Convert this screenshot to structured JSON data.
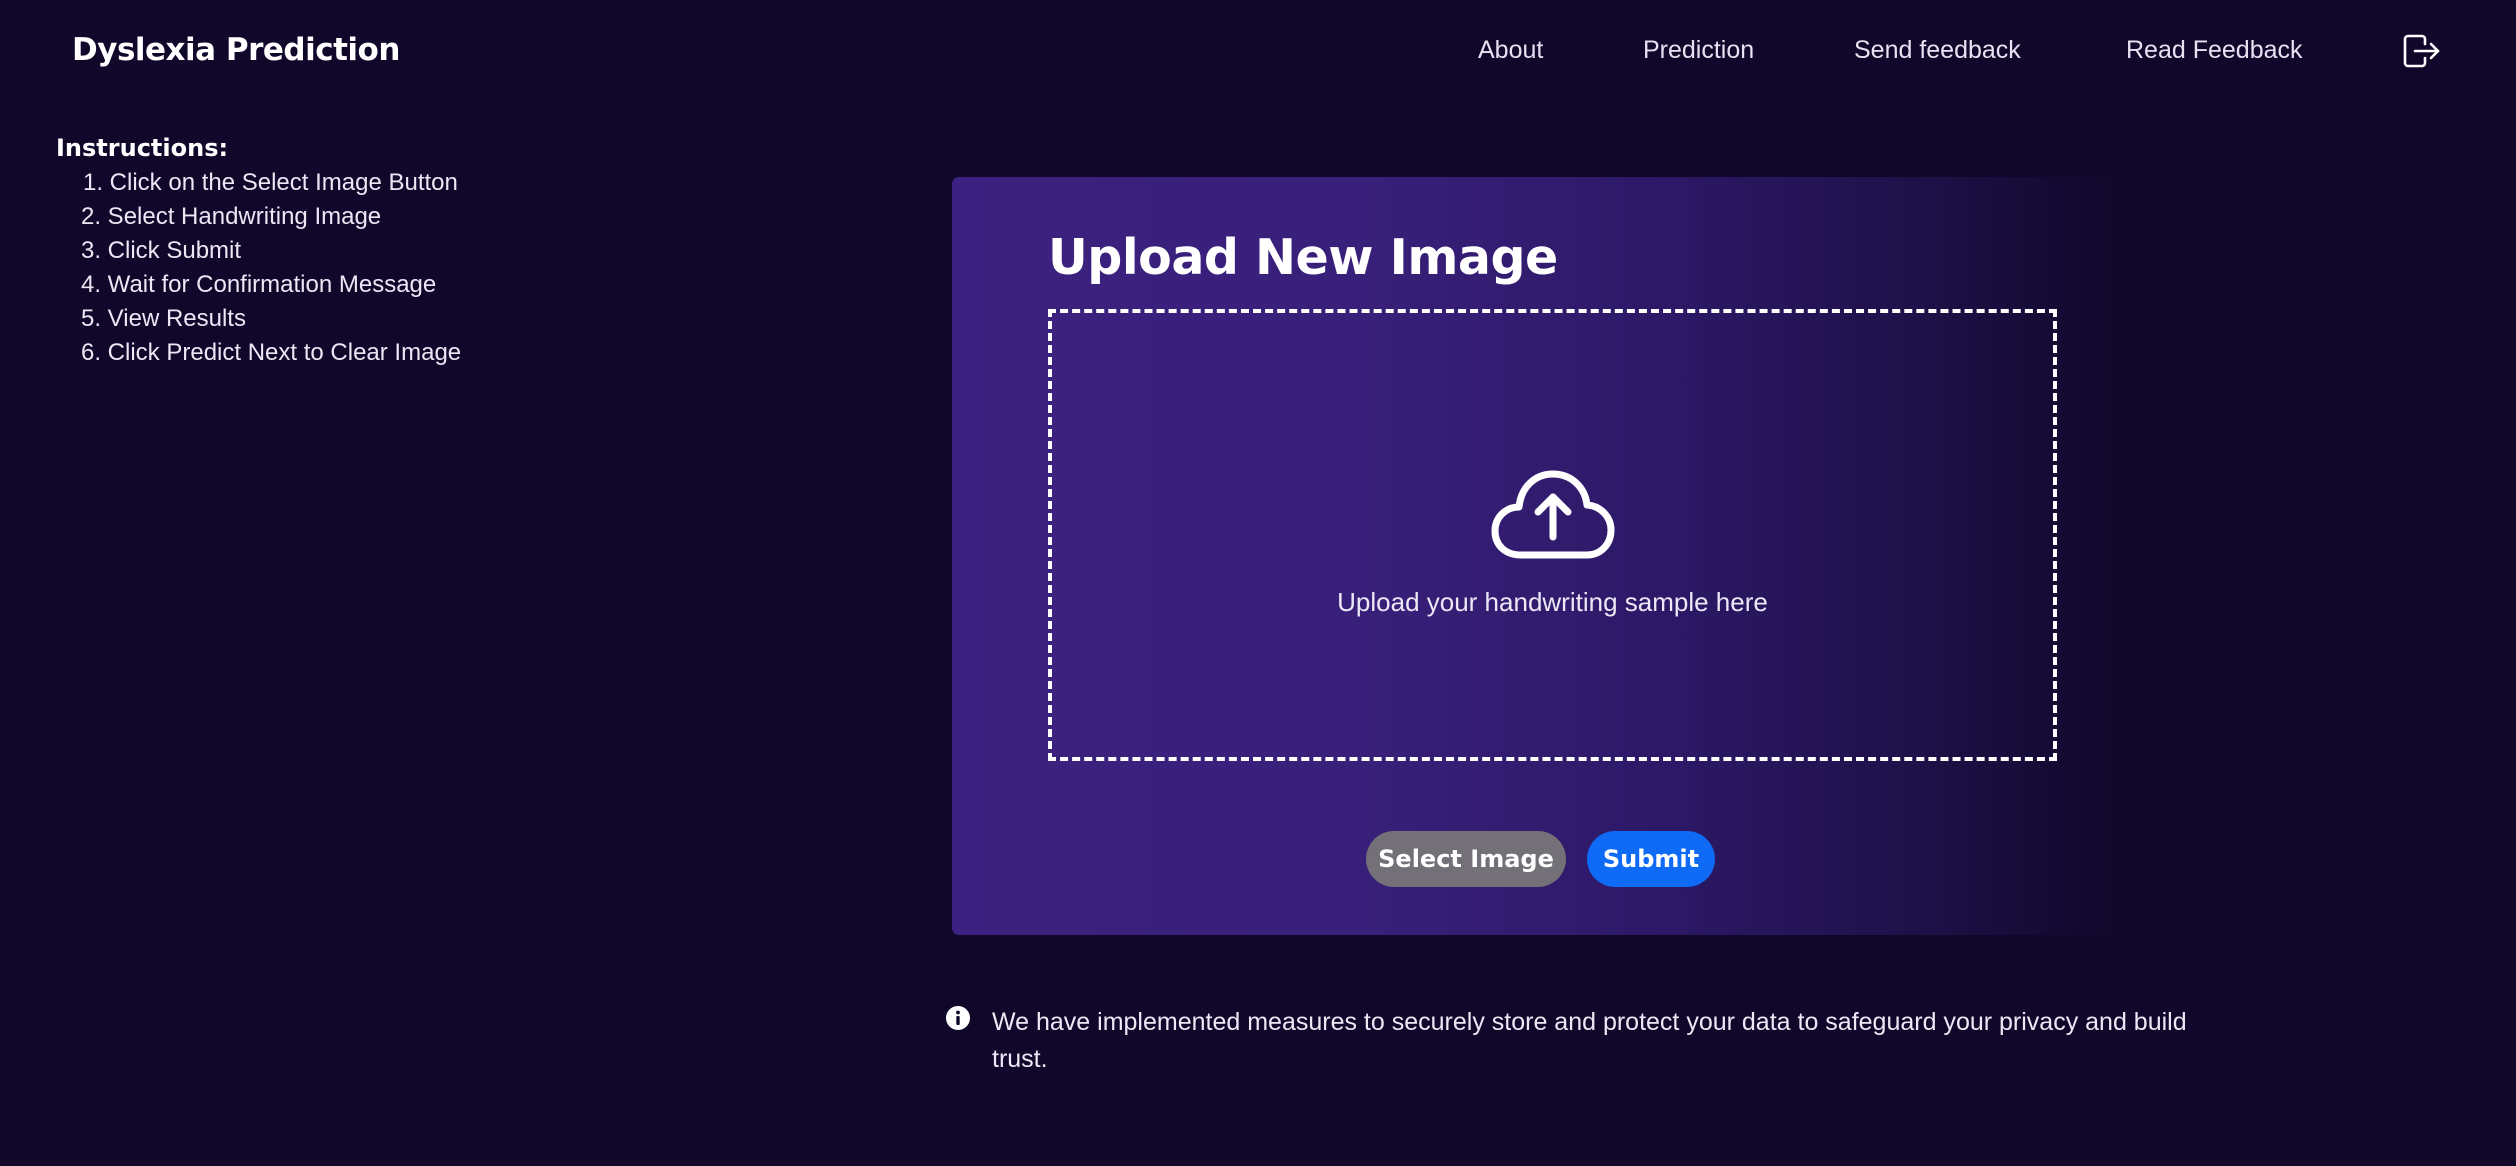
{
  "header": {
    "brand": "Dyslexia Prediction",
    "nav": [
      {
        "label": "About"
      },
      {
        "label": "Prediction"
      },
      {
        "label": "Send feedback"
      },
      {
        "label": "Read Feedback"
      }
    ],
    "logout_icon": "logout-icon"
  },
  "instructions": {
    "title": "Instructions:",
    "steps": [
      "1. Click on the Select Image Button",
      "2. Select Handwriting Image",
      "3. Click Submit",
      "4. Wait for Confirmation Message",
      "5. View Results",
      "6. Click Predict Next to Clear Image"
    ]
  },
  "upload": {
    "title": "Upload New Image",
    "dropzone_text": "Upload your handwriting sample here",
    "icon": "cloud-upload-icon",
    "select_button": "Select Image",
    "submit_button": "Submit"
  },
  "info": {
    "icon": "info-icon",
    "text": "We have implemented measures to securely store and protect your data to safeguard your privacy and build trust."
  },
  "colors": {
    "background": "#10072a",
    "card_gradient_start": "#3d2180",
    "select_button": "#737078",
    "submit_button": "#0f6af5"
  }
}
